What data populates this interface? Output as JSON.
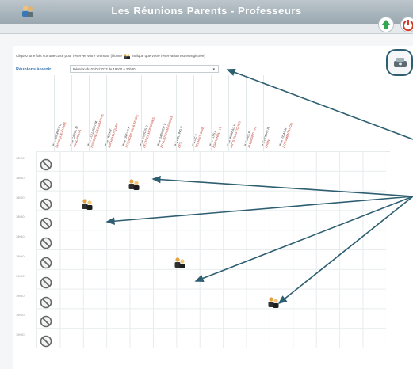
{
  "header": {
    "title": "Les Réunions Parents - Professeurs"
  },
  "instructions": {
    "text_before": "Cliquez une fois sur une case pour réserver votre créneau (l'icône",
    "text_after": "indique que votre réservation est enregistrée)",
    "reunion_label": "Réunions à venir",
    "reunion_select_value": "Réunion du 03/01/2013 de 18h00 à 20h00"
  },
  "teachers": [
    {
      "name": "Mme ANDRIEU G",
      "subject": "PHYSIQUE-CHIMIE"
    },
    {
      "name": "Mme CAROL M",
      "subject": "ANGLAIS LV1"
    },
    {
      "name": "Mme COLLAERT M",
      "subject": "HISTOIRE-GEOGRAPHIE"
    },
    {
      "name": "Mme DECK F",
      "subject": "MATHEMATIQUES"
    },
    {
      "name": "Mme DREUX P",
      "subject": "SCIENCES VIE & TERRE"
    },
    {
      "name": "Mme DUBOIS C",
      "subject": "LETTRES MODERNES"
    },
    {
      "name": "Mme GARNIER V",
      "subject": "EDUCATION MUSICALE"
    },
    {
      "name": "M. LEBLOND G",
      "subject": "EPS"
    },
    {
      "name": "M. LUC S",
      "subject": "TECHNOLOGIE"
    },
    {
      "name": "Mme LUIS A",
      "subject": "ESPAGNOL LV2"
    },
    {
      "name": "Mme MOREAU H",
      "subject": "ARTS PLASTIQUES"
    },
    {
      "name": "M. PARIS B",
      "subject": "ALLEMAND LV2"
    },
    {
      "name": "M. THOMAS R",
      "subject": "LATIN"
    },
    {
      "name": "Mme VIDAL M",
      "subject": "DOCUMENTATION"
    }
  ],
  "time_slots": [
    "18h00",
    "18h10",
    "18h20",
    "18h30",
    "18h40",
    "18h50",
    "19h00",
    "19h10",
    "19h20",
    "19h30"
  ],
  "bookings": [
    {
      "slot": 1,
      "teacher": 3
    },
    {
      "slot": 2,
      "teacher": 1
    },
    {
      "slot": 5,
      "teacher": 5
    },
    {
      "slot": 7,
      "teacher": 9
    }
  ],
  "icons": {
    "logo": "parents-icon",
    "home": "green-arrow-up-icon",
    "power": "power-icon",
    "settings": "settings-icon",
    "no_slot": "no-entry-icon",
    "booked": "parent-teacher-icon"
  },
  "colors": {
    "link_blue": "#3a77b6",
    "subject_red": "#c0392b",
    "annotation_teal": "#2e5f71",
    "header_grey": "#9aa8b0"
  }
}
